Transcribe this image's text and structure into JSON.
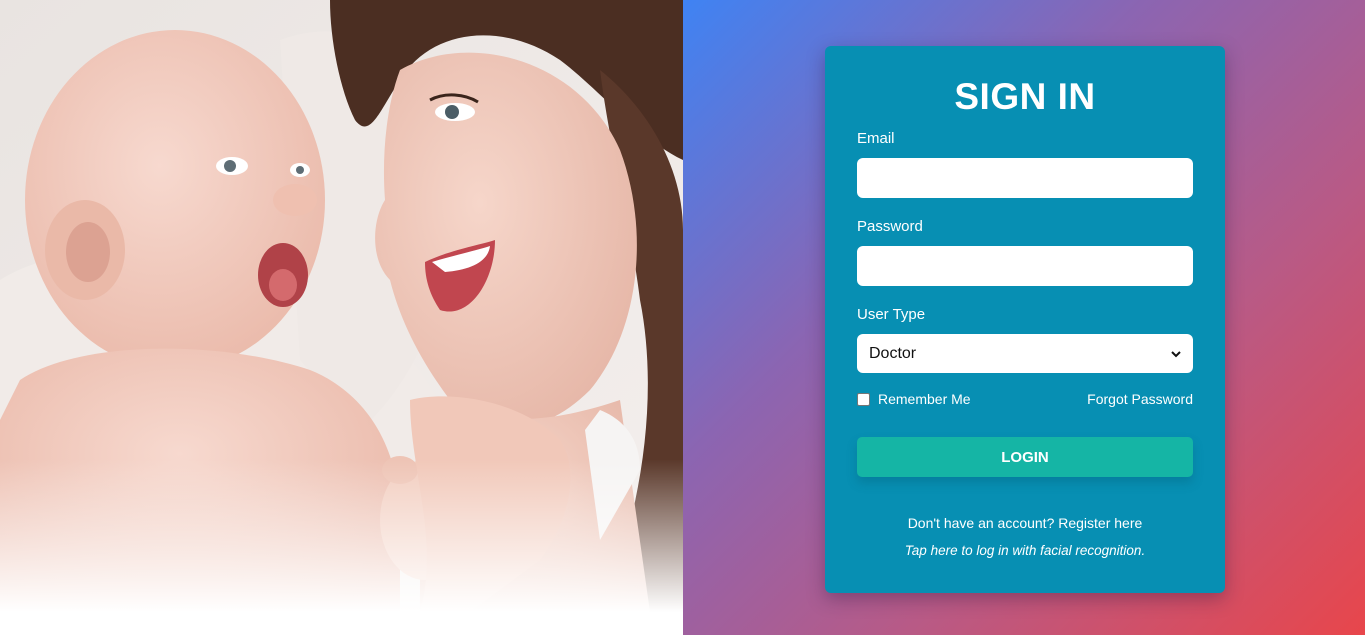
{
  "signin": {
    "title": "SIGN IN",
    "email_label": "Email",
    "email_value": "",
    "password_label": "Password",
    "password_value": "",
    "user_type_label": "User Type",
    "user_type_selected": "Doctor",
    "remember_label": "Remember Me",
    "remember_checked": false,
    "forgot_label": "Forgot Password",
    "login_label": "LOGIN",
    "register_prefix": "Don't have an account?",
    "register_link": "Register here",
    "facial_link": "Tap here to log in with facial recognition."
  },
  "icons": {
    "select_arrow": "chevron-down-icon",
    "checkbox": "checkbox-icon"
  },
  "colors": {
    "card_bg": "#078fb3",
    "login_button": "#15b5a5",
    "gradient_start": "#3f83f3",
    "gradient_end": "#e8464b"
  }
}
